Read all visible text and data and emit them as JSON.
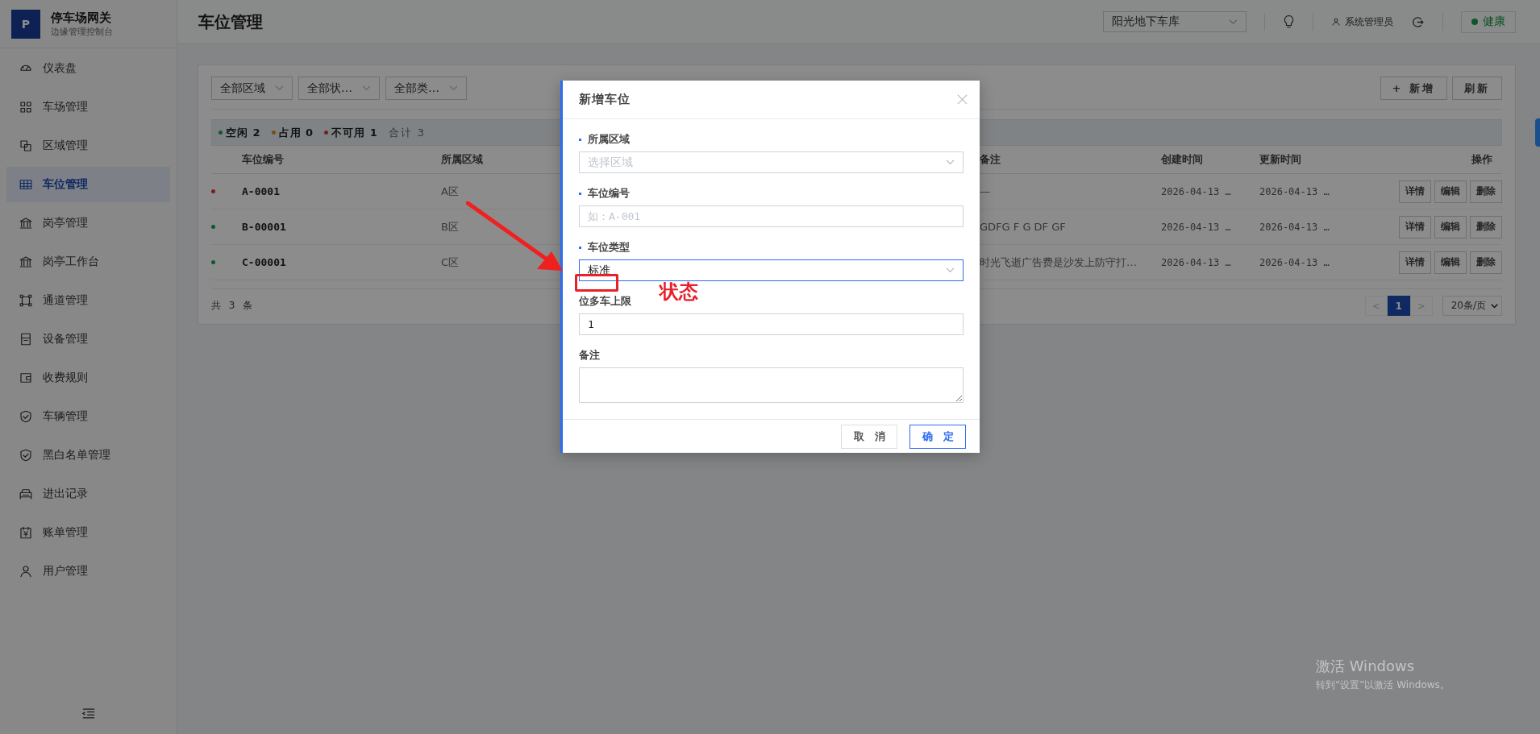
{
  "brand": {
    "logo": "P",
    "title": "停车场网关",
    "subtitle": "边缘管理控制台"
  },
  "sidebar": {
    "items": [
      {
        "label": "仪表盘",
        "selected": false
      },
      {
        "label": "车场管理",
        "selected": false
      },
      {
        "label": "区域管理",
        "selected": false
      },
      {
        "label": "车位管理",
        "selected": true
      },
      {
        "label": "岗亭管理",
        "selected": false
      },
      {
        "label": "岗亭工作台",
        "selected": false
      },
      {
        "label": "通道管理",
        "selected": false
      },
      {
        "label": "设备管理",
        "selected": false
      },
      {
        "label": "收费规则",
        "selected": false
      },
      {
        "label": "车辆管理",
        "selected": false
      },
      {
        "label": "黑白名单管理",
        "selected": false
      },
      {
        "label": "进出记录",
        "selected": false
      },
      {
        "label": "账单管理",
        "selected": false
      },
      {
        "label": "用户管理",
        "selected": false
      }
    ]
  },
  "header": {
    "title": "车位管理",
    "garage_select": "阳光地下车库",
    "user": "系统管理员",
    "health": "健康"
  },
  "filters": [
    "全部区域",
    "全部状…",
    "全部类…"
  ],
  "toolbar_buttons": [
    "+ 新增",
    "刷新"
  ],
  "summary": {
    "items": [
      {
        "label": "空闲",
        "count": "2",
        "color": "#12572c"
      },
      {
        "label": "占用",
        "count": "0",
        "color": "#7a4d10"
      },
      {
        "label": "不可用",
        "count": "1",
        "color": "#76201c"
      }
    ],
    "total_label": "合计",
    "total": "3"
  },
  "table": {
    "columns": [
      "车位编号",
      "所属区域",
      "备注",
      "创建时间",
      "更新时间",
      "操作"
    ],
    "rows": [
      {
        "color": "#76201c",
        "code": "A-0001",
        "zone": "A区",
        "note": "—",
        "created": "2026-04-13 …",
        "updated": "2026-04-13 …",
        "actions": [
          "详情",
          "编辑",
          "删除"
        ]
      },
      {
        "color": "#12572c",
        "code": "B-00001",
        "zone": "B区",
        "note": "GDFG F G DF GF",
        "created": "2026-04-13 …",
        "updated": "2026-04-13 …",
        "actions": [
          "详情",
          "编辑",
          "删除"
        ]
      },
      {
        "color": "#12572c",
        "code": "C-00001",
        "zone": "C区",
        "note": "时光飞逝广告费是沙发上防守打…",
        "created": "2026-04-13 …",
        "updated": "2026-04-13 …",
        "actions": [
          "详情",
          "编辑",
          "删除"
        ]
      }
    ]
  },
  "footer": {
    "total": "共 3 条",
    "prev": "<",
    "pages": [
      {
        "label": "1",
        "selected": true
      }
    ],
    "next": ">",
    "page_size": "20条/页"
  },
  "modal": {
    "title": "新增车位",
    "fields": [
      {
        "kind": "select",
        "label": "所属区域",
        "required": true,
        "focused": false,
        "placeholder": "选择区域"
      },
      {
        "kind": "input",
        "label": "车位编号",
        "required": true,
        "focused": false,
        "placeholder": "如：A-001"
      },
      {
        "kind": "select",
        "label": "车位类型",
        "required": true,
        "focused": true,
        "value": "标准"
      },
      {
        "kind": "input",
        "label": "位多车上限",
        "required": false,
        "focused": false,
        "value": "1"
      },
      {
        "kind": "textarea",
        "label": "备注",
        "required": false,
        "focused": false
      }
    ],
    "cancel": "取　消",
    "confirm": "确　定"
  },
  "annotation": {
    "text": "状态"
  },
  "os_notice": {
    "title": "激活 Windows",
    "text": "转到“设置”以激活 Windows。"
  }
}
